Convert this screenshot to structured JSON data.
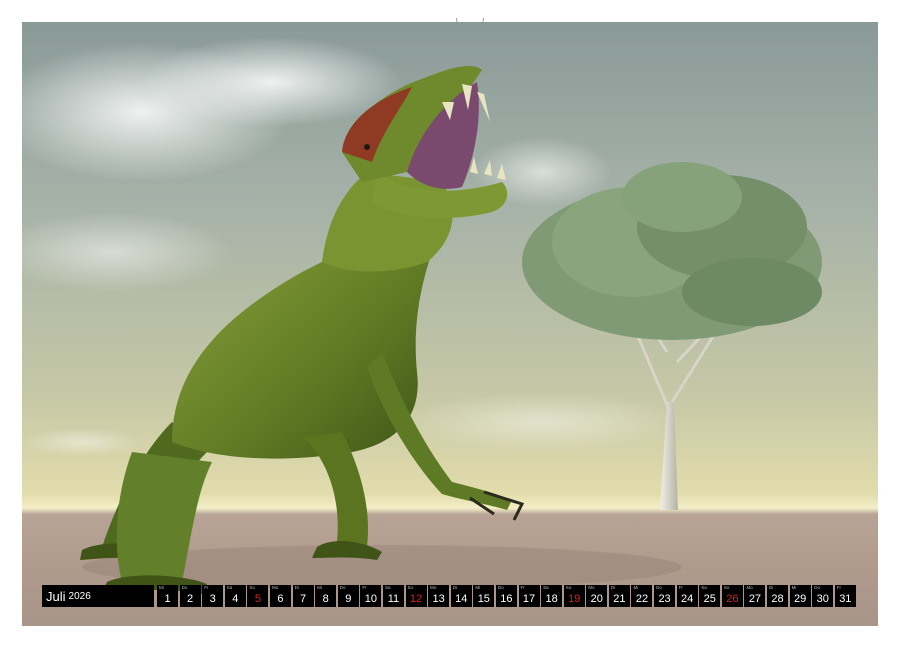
{
  "calendar": {
    "month": "Juli",
    "year": "2026",
    "days": [
      {
        "wd": "Mi",
        "num": "1",
        "sun": false
      },
      {
        "wd": "Do",
        "num": "2",
        "sun": false
      },
      {
        "wd": "Fr",
        "num": "3",
        "sun": false
      },
      {
        "wd": "Sa",
        "num": "4",
        "sun": false
      },
      {
        "wd": "So",
        "num": "5",
        "sun": true
      },
      {
        "wd": "Mo",
        "num": "6",
        "sun": false
      },
      {
        "wd": "Di",
        "num": "7",
        "sun": false
      },
      {
        "wd": "Mi",
        "num": "8",
        "sun": false
      },
      {
        "wd": "Do",
        "num": "9",
        "sun": false
      },
      {
        "wd": "Fr",
        "num": "10",
        "sun": false
      },
      {
        "wd": "Sa",
        "num": "11",
        "sun": false
      },
      {
        "wd": "So",
        "num": "12",
        "sun": true
      },
      {
        "wd": "Mo",
        "num": "13",
        "sun": false
      },
      {
        "wd": "Di",
        "num": "14",
        "sun": false
      },
      {
        "wd": "Mi",
        "num": "15",
        "sun": false
      },
      {
        "wd": "Do",
        "num": "16",
        "sun": false
      },
      {
        "wd": "Fr",
        "num": "17",
        "sun": false
      },
      {
        "wd": "Sa",
        "num": "18",
        "sun": false
      },
      {
        "wd": "So",
        "num": "19",
        "sun": true
      },
      {
        "wd": "Mo",
        "num": "20",
        "sun": false
      },
      {
        "wd": "Di",
        "num": "21",
        "sun": false
      },
      {
        "wd": "Mi",
        "num": "22",
        "sun": false
      },
      {
        "wd": "Do",
        "num": "23",
        "sun": false
      },
      {
        "wd": "Fr",
        "num": "24",
        "sun": false
      },
      {
        "wd": "Sa",
        "num": "25",
        "sun": false
      },
      {
        "wd": "So",
        "num": "26",
        "sun": true
      },
      {
        "wd": "Mo",
        "num": "27",
        "sun": false
      },
      {
        "wd": "Di",
        "num": "28",
        "sun": false
      },
      {
        "wd": "Mi",
        "num": "29",
        "sun": false
      },
      {
        "wd": "Do",
        "num": "30",
        "sun": false
      },
      {
        "wd": "Fr",
        "num": "31",
        "sun": false
      }
    ]
  },
  "colors": {
    "sunday": "#e21d1d",
    "bar": "#000000",
    "dino_green": "#6f8a2c",
    "dino_crest": "#8f3a22"
  },
  "icons": {
    "binding": "spiral-binding-holes"
  }
}
